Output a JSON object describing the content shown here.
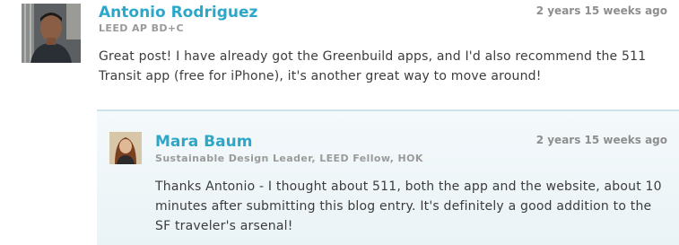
{
  "comment": {
    "author": "Antonio Rodriguez",
    "credential": "LEED AP BD+C",
    "timestamp": "2 years 15 weeks ago",
    "body": "Great post! I have already got the Greenbuild apps, and I'd also recommend the 511 Transit app (free for iPhone), it's another great way to move around!",
    "avatar_icon": "user-photo"
  },
  "reply": {
    "author": "Mara Baum",
    "credential": "Sustainable Design Leader, LEED Fellow, HOK",
    "timestamp": "2 years 15 weeks ago",
    "body": "Thanks Antonio - I thought about 511, both the app and the website, about 10 minutes after submitting this blog entry. It's definitely a good addition to the SF traveler's arsenal!",
    "avatar_icon": "user-photo"
  },
  "colors": {
    "author_link": "#2ba8c9",
    "credential": "#9a9a9a",
    "timestamp": "#8e8e8e",
    "body": "#3c3c3c",
    "reply_background": "#eef6f8",
    "reply_border": "#cfe4ea"
  }
}
